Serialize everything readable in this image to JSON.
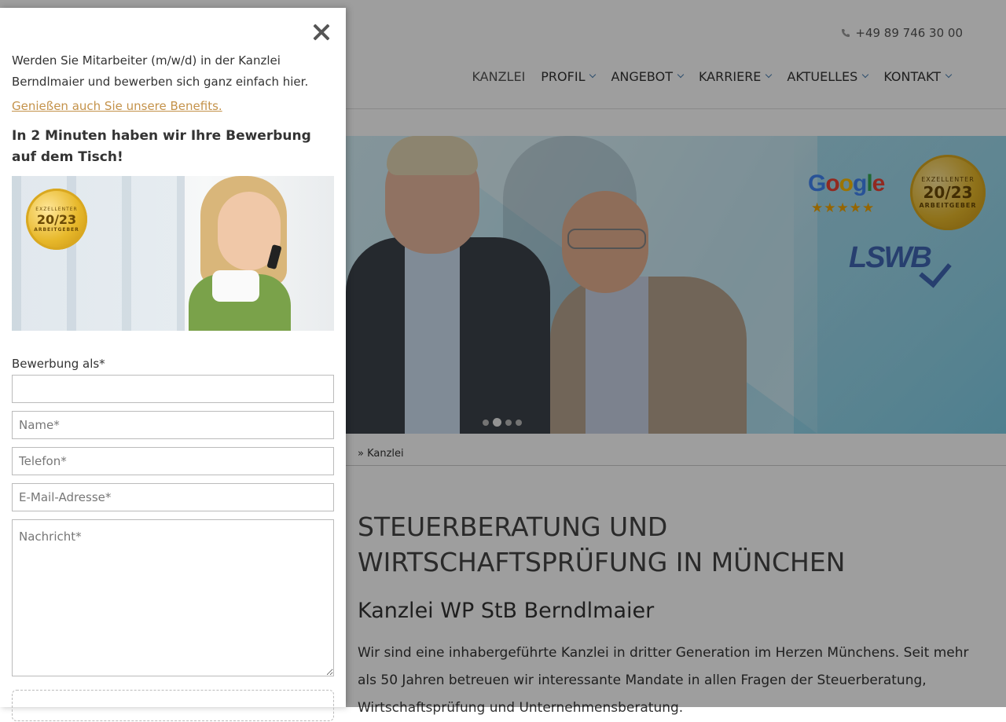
{
  "header": {
    "phone": "+49 89 746 30 00",
    "nav": [
      {
        "label": "KANZLEI",
        "dropdown": false
      },
      {
        "label": "PROFIL",
        "dropdown": true
      },
      {
        "label": "ANGEBOT",
        "dropdown": true
      },
      {
        "label": "KARRIERE",
        "dropdown": true
      },
      {
        "label": "AKTUELLES",
        "dropdown": true
      },
      {
        "label": "KONTAKT",
        "dropdown": true
      }
    ]
  },
  "hero": {
    "badges": {
      "google_rating_stars": 5,
      "seal": {
        "top": "EXZELLENTER",
        "year_a": "20",
        "year_b": "23",
        "bottom": "ARBEITGEBER"
      },
      "lswb": "LSWB"
    },
    "slider_dots": 4,
    "active_dot": 1
  },
  "breadcrumb": "» Kanzlei",
  "content": {
    "title": "STEUERBERATUNG UND WIRTSCHAFTSPRÜFUNG IN MÜNCHEN",
    "subtitle": "Kanzlei WP StB Berndlmaier",
    "paragraph": "Wir sind eine inhabergeführte Kanzlei in dritter Generation im Herzen Münchens. Seit mehr als 50 Jahren betreuen wir interessante Mandate in allen Fragen der Steuerberatung, Wirtschaftsprüfung und Unternehmensberatung."
  },
  "panel": {
    "intro": "Werden Sie Mitarbeiter (m/w/d) in der Kanzlei Berndlmaier und bewerben sich ganz einfach hier.",
    "benefits_link": "Genießen auch Sie unsere Benefits.",
    "headline": "In 2 Minuten haben wir Ihre Bewerbung auf dem Tisch!",
    "seal": {
      "top": "EXZELLENTER",
      "year_a": "20",
      "year_b": "23",
      "bottom": "ARBEITGEBER"
    },
    "form": {
      "position_label": "Bewerbung als*",
      "position_value": "",
      "name_placeholder": "Name*",
      "phone_placeholder": "Telefon*",
      "email_placeholder": "E-Mail-Adresse*",
      "message_placeholder": "Nachricht*"
    }
  },
  "colors": {
    "link": "#c4924a",
    "accent_blue": "#3f67b4",
    "overlay": "rgba(0,0,0,0.38)"
  }
}
